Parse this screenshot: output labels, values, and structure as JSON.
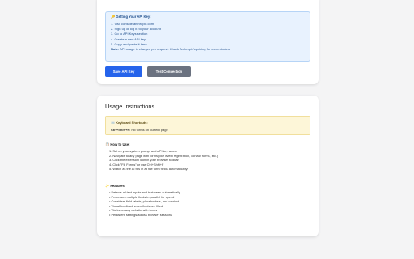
{
  "api_key_box": {
    "title": "🔑 Getting Your API Key:",
    "steps": [
      "1. Visit console.anthropic.com",
      "2. Sign up or log in to your account",
      "3. Go to API Keys section",
      "4. Create a new API key",
      "5. Copy and paste it here"
    ],
    "note_label": "Note:",
    "note_text": " API usage is charged per request. Check Anthropic's pricing for current rates."
  },
  "buttons": {
    "save_label": "Save API Key",
    "test_label": "Test Connection"
  },
  "usage": {
    "title": "Usage Instructions",
    "shortcuts_title": "⌨️ Keyboard Shortcuts:",
    "shortcut_key": "Ctrl+Shift+F:",
    "shortcut_desc": " Fill forms on current page",
    "howto_title": "📋 How to Use:",
    "howto_steps": [
      "1. Set up your system prompt and API key above",
      "2. Navigate to any page with forms (like event registration, contact forms, etc.)",
      "3. Click the extension icon in your browser toolbar",
      "4. Click \"Fill Forms\" or use Ctrl+Shift+F",
      "5. Watch as the AI fills in all the form fields automatically!"
    ],
    "features_title": "✨ Features:",
    "features": [
      "• Detects all text inputs and textareas automatically",
      "• Processes multiple fields in parallel for speed",
      "• Considers field labels, placeholders, and context",
      "• Visual feedback when fields are filled",
      "• Works on any website with forms",
      "• Persistent settings across browser sessions"
    ]
  }
}
